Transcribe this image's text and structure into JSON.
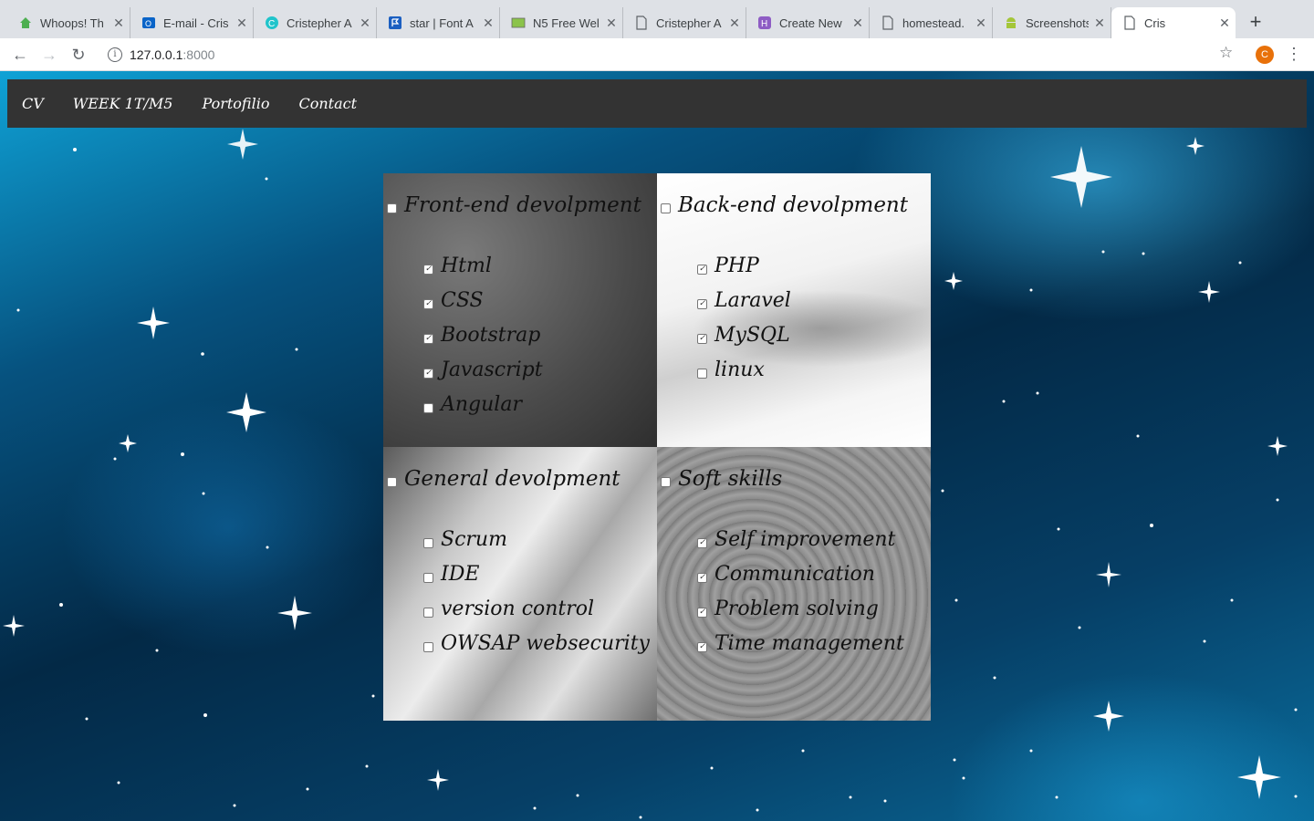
{
  "browser": {
    "tabs": [
      {
        "title": "Whoops! Th",
        "icon": "laravel-house-icon"
      },
      {
        "title": "E-mail - Cris",
        "icon": "outlook-icon"
      },
      {
        "title": "Cristepher A",
        "icon": "c-circle-icon"
      },
      {
        "title": "star | Font A",
        "icon": "flag-icon"
      },
      {
        "title": "N5 Free Wel",
        "icon": "image-icon"
      },
      {
        "title": "Cristepher A",
        "icon": "document-icon"
      },
      {
        "title": "Create New",
        "icon": "h-square-icon"
      },
      {
        "title": "homestead.",
        "icon": "document-icon"
      },
      {
        "title": "Screenshots",
        "icon": "android-icon"
      },
      {
        "title": "Cris",
        "icon": "document-icon",
        "active": true
      }
    ],
    "url_host": "127.0.0.1",
    "url_port": ":8000",
    "profile_initial": "C",
    "profile_color": "#e8710a"
  },
  "nav": {
    "cv": "CV",
    "week": "WEEK 1T/M5",
    "portfolio": "Portofilio",
    "contact": "Contact"
  },
  "sections": {
    "front": {
      "title": "Front-end devolpment",
      "checked": false,
      "items": [
        {
          "label": "Html",
          "checked": true
        },
        {
          "label": "CSS",
          "checked": true
        },
        {
          "label": "Bootstrap",
          "checked": true
        },
        {
          "label": "Javascript",
          "checked": true
        },
        {
          "label": "Angular",
          "checked": false
        }
      ]
    },
    "back": {
      "title": "Back-end devolpment",
      "checked": false,
      "items": [
        {
          "label": "PHP",
          "checked": true
        },
        {
          "label": "Laravel",
          "checked": true
        },
        {
          "label": "MySQL",
          "checked": true
        },
        {
          "label": "linux",
          "checked": false
        }
      ]
    },
    "general": {
      "title": "General devolpment",
      "checked": false,
      "items": [
        {
          "label": "Scrum",
          "checked": false
        },
        {
          "label": "IDE",
          "checked": false
        },
        {
          "label": "version control",
          "checked": false
        },
        {
          "label": "OWSAP websecurity",
          "checked": false
        }
      ]
    },
    "soft": {
      "title": "Soft skills",
      "checked": false,
      "items": [
        {
          "label": "Self improvement",
          "checked": true
        },
        {
          "label": "Communication",
          "checked": true
        },
        {
          "label": "Problem solving",
          "checked": true
        },
        {
          "label": "Time management",
          "checked": true
        }
      ]
    }
  }
}
